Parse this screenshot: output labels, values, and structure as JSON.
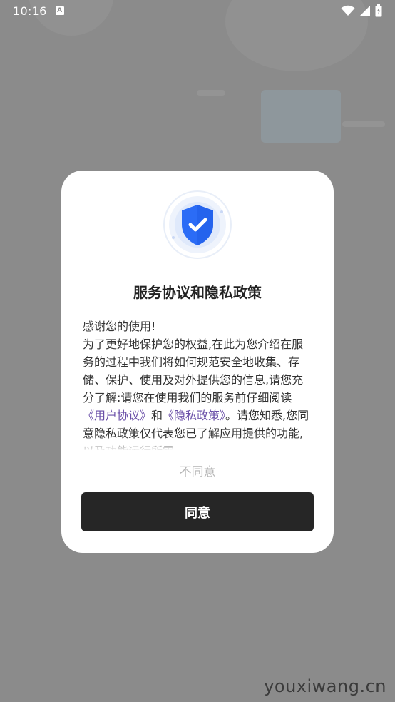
{
  "status_bar": {
    "time": "10:16",
    "notification_icon_letter": "A",
    "icons": [
      "wifi-icon",
      "signal-icon",
      "battery-icon"
    ]
  },
  "dialog": {
    "title": "服务协议和隐私政策",
    "shield_color": "#2b6cf6",
    "body": {
      "greeting": "感谢您的使用!",
      "para_before_links": "为了更好地保护您的权益,在此为您介绍在服务的过程中我们将如何规范安全地收集、存储、保护、使用及对外提供您的信息,请您充分了解:请您在使用我们的服务前仔细阅读",
      "user_agreement_link": "《用户协议》",
      "and_text": "和",
      "privacy_policy_link": "《隐私政策》",
      "para_after_links": "。请您知悉,您同意隐私政策仅代表您已了解应用提供的功能,以及功能运行所需"
    },
    "link_color": "#6a4fa8",
    "disagree_label": "不同意",
    "agree_label": "同意"
  },
  "watermark": "youxiwang.cn"
}
